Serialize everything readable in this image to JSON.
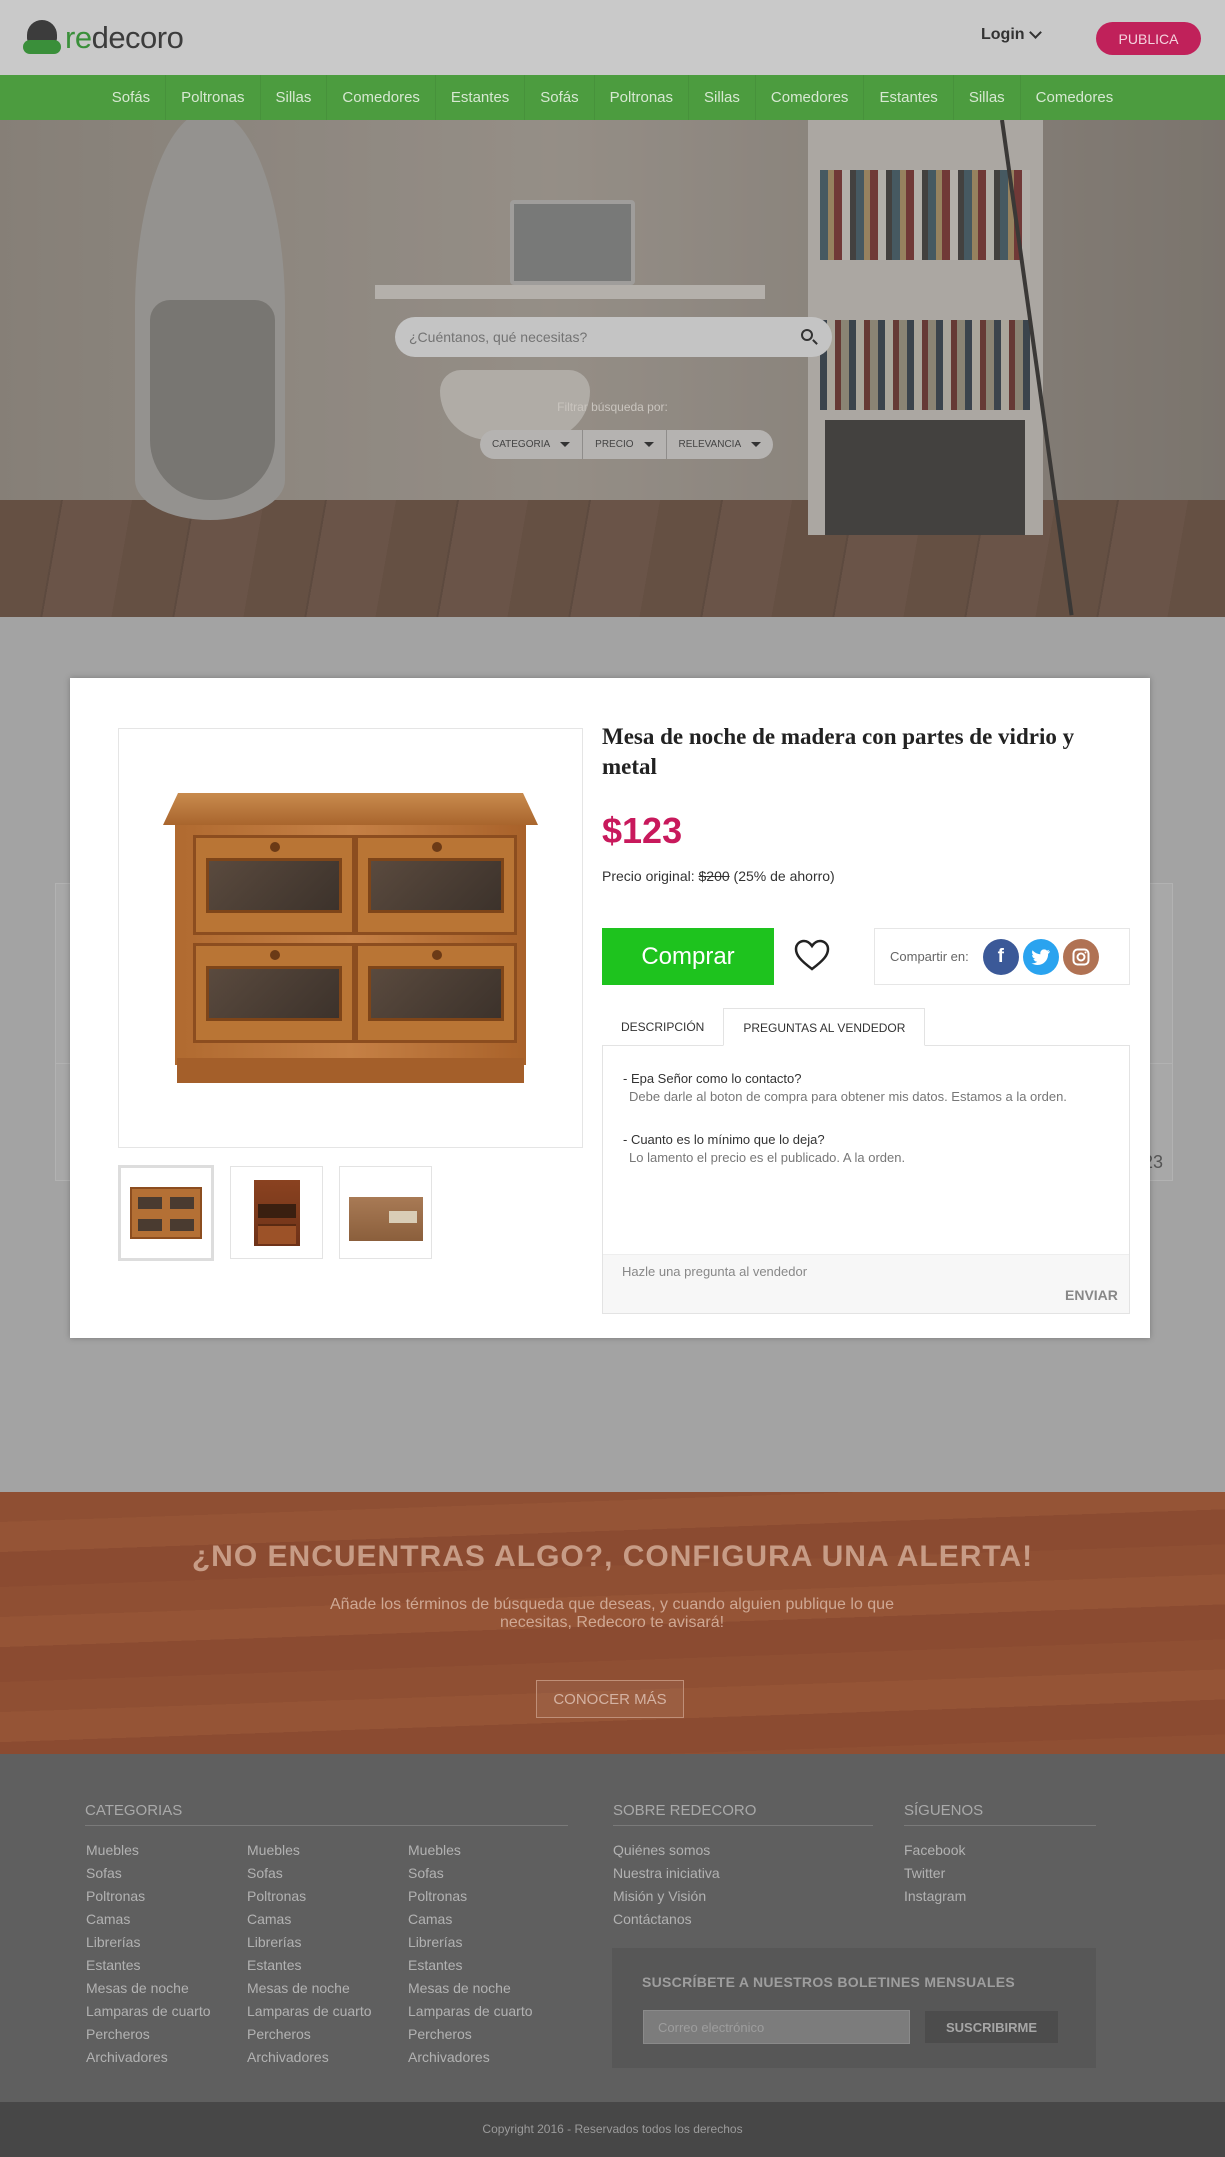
{
  "header": {
    "logo_re": "re",
    "logo_rest": "decoro",
    "login_label": "Login",
    "publish_label": "PUBLICA"
  },
  "nav": {
    "items": [
      "Sofás",
      "Poltronas",
      "Sillas",
      "Comedores",
      "Estantes",
      "Sofás",
      "Poltronas",
      "Sillas",
      "Comedores",
      "Estantes",
      "Sillas",
      "Comedores"
    ]
  },
  "hero": {
    "search_placeholder": "¿Cuéntanos, qué necesitas?",
    "filter_label": "Filtrar búsqueda por:",
    "filters": [
      "CATEGORIA",
      "PRECIO",
      "RELEVANCIA"
    ]
  },
  "background_card": {
    "partial_number": "23"
  },
  "product": {
    "title": "Mesa de noche de madera con partes de vidrio y metal",
    "price": "$123",
    "original_label": "Precio original:",
    "original_price": "$200",
    "savings": "(25% de ahorro)",
    "buy_label": "Comprar",
    "share_label": "Compartir en:",
    "social": [
      "facebook",
      "twitter",
      "instagram"
    ],
    "tabs": [
      {
        "label": "DESCRIPCIÓN",
        "active": false
      },
      {
        "label": "PREGUNTAS AL VENDEDOR",
        "active": true
      }
    ],
    "questions": [
      {
        "q": "- Epa Señor como lo contacto?",
        "a": "Debe darle al boton de compra para obtener mis datos. Estamos a la orden."
      },
      {
        "q": "- Cuanto es lo mínimo que lo deja?",
        "a": "Lo lamento el precio es el publicado. A la orden."
      }
    ],
    "ask_placeholder": "Hazle una pregunta al vendedor",
    "send_label": "ENVIAR"
  },
  "alert": {
    "title": "¿NO ENCUENTRAS ALGO?, CONFIGURA UNA ALERTA!",
    "text": "Añade los términos de búsqueda que deseas, y cuando alguien publique lo que necesitas, Redecoro te avisará!",
    "button": "CONOCER MÁS"
  },
  "footer": {
    "categories_title": "CATEGORIAS",
    "categories": [
      "Muebles",
      "Sofas",
      "Poltronas",
      "Camas",
      "Librerías",
      "Estantes",
      "Mesas de noche",
      "Lamparas de cuarto",
      "Percheros",
      "Archivadores"
    ],
    "about_title": "SOBRE REDECORO",
    "about": [
      "Quiénes somos",
      "Nuestra iniciativa",
      "Misión y Visión",
      "Contáctanos"
    ],
    "follow_title": "SÍGUENOS",
    "follow": [
      "Facebook",
      "Twitter",
      "Instagram"
    ],
    "newsletter_title": "SUSCRÍBETE A NUESTROS BOLETINES MENSUALES",
    "email_placeholder": "Correo electrónico",
    "subscribe_label": "SUSCRIBIRME"
  },
  "copyright": "Copyright 2016 - Reservados todos los derechos",
  "colors": {
    "brand_green": "#4c9c3f",
    "accent_pink": "#c8195c",
    "buy_green": "#1ec31e"
  }
}
